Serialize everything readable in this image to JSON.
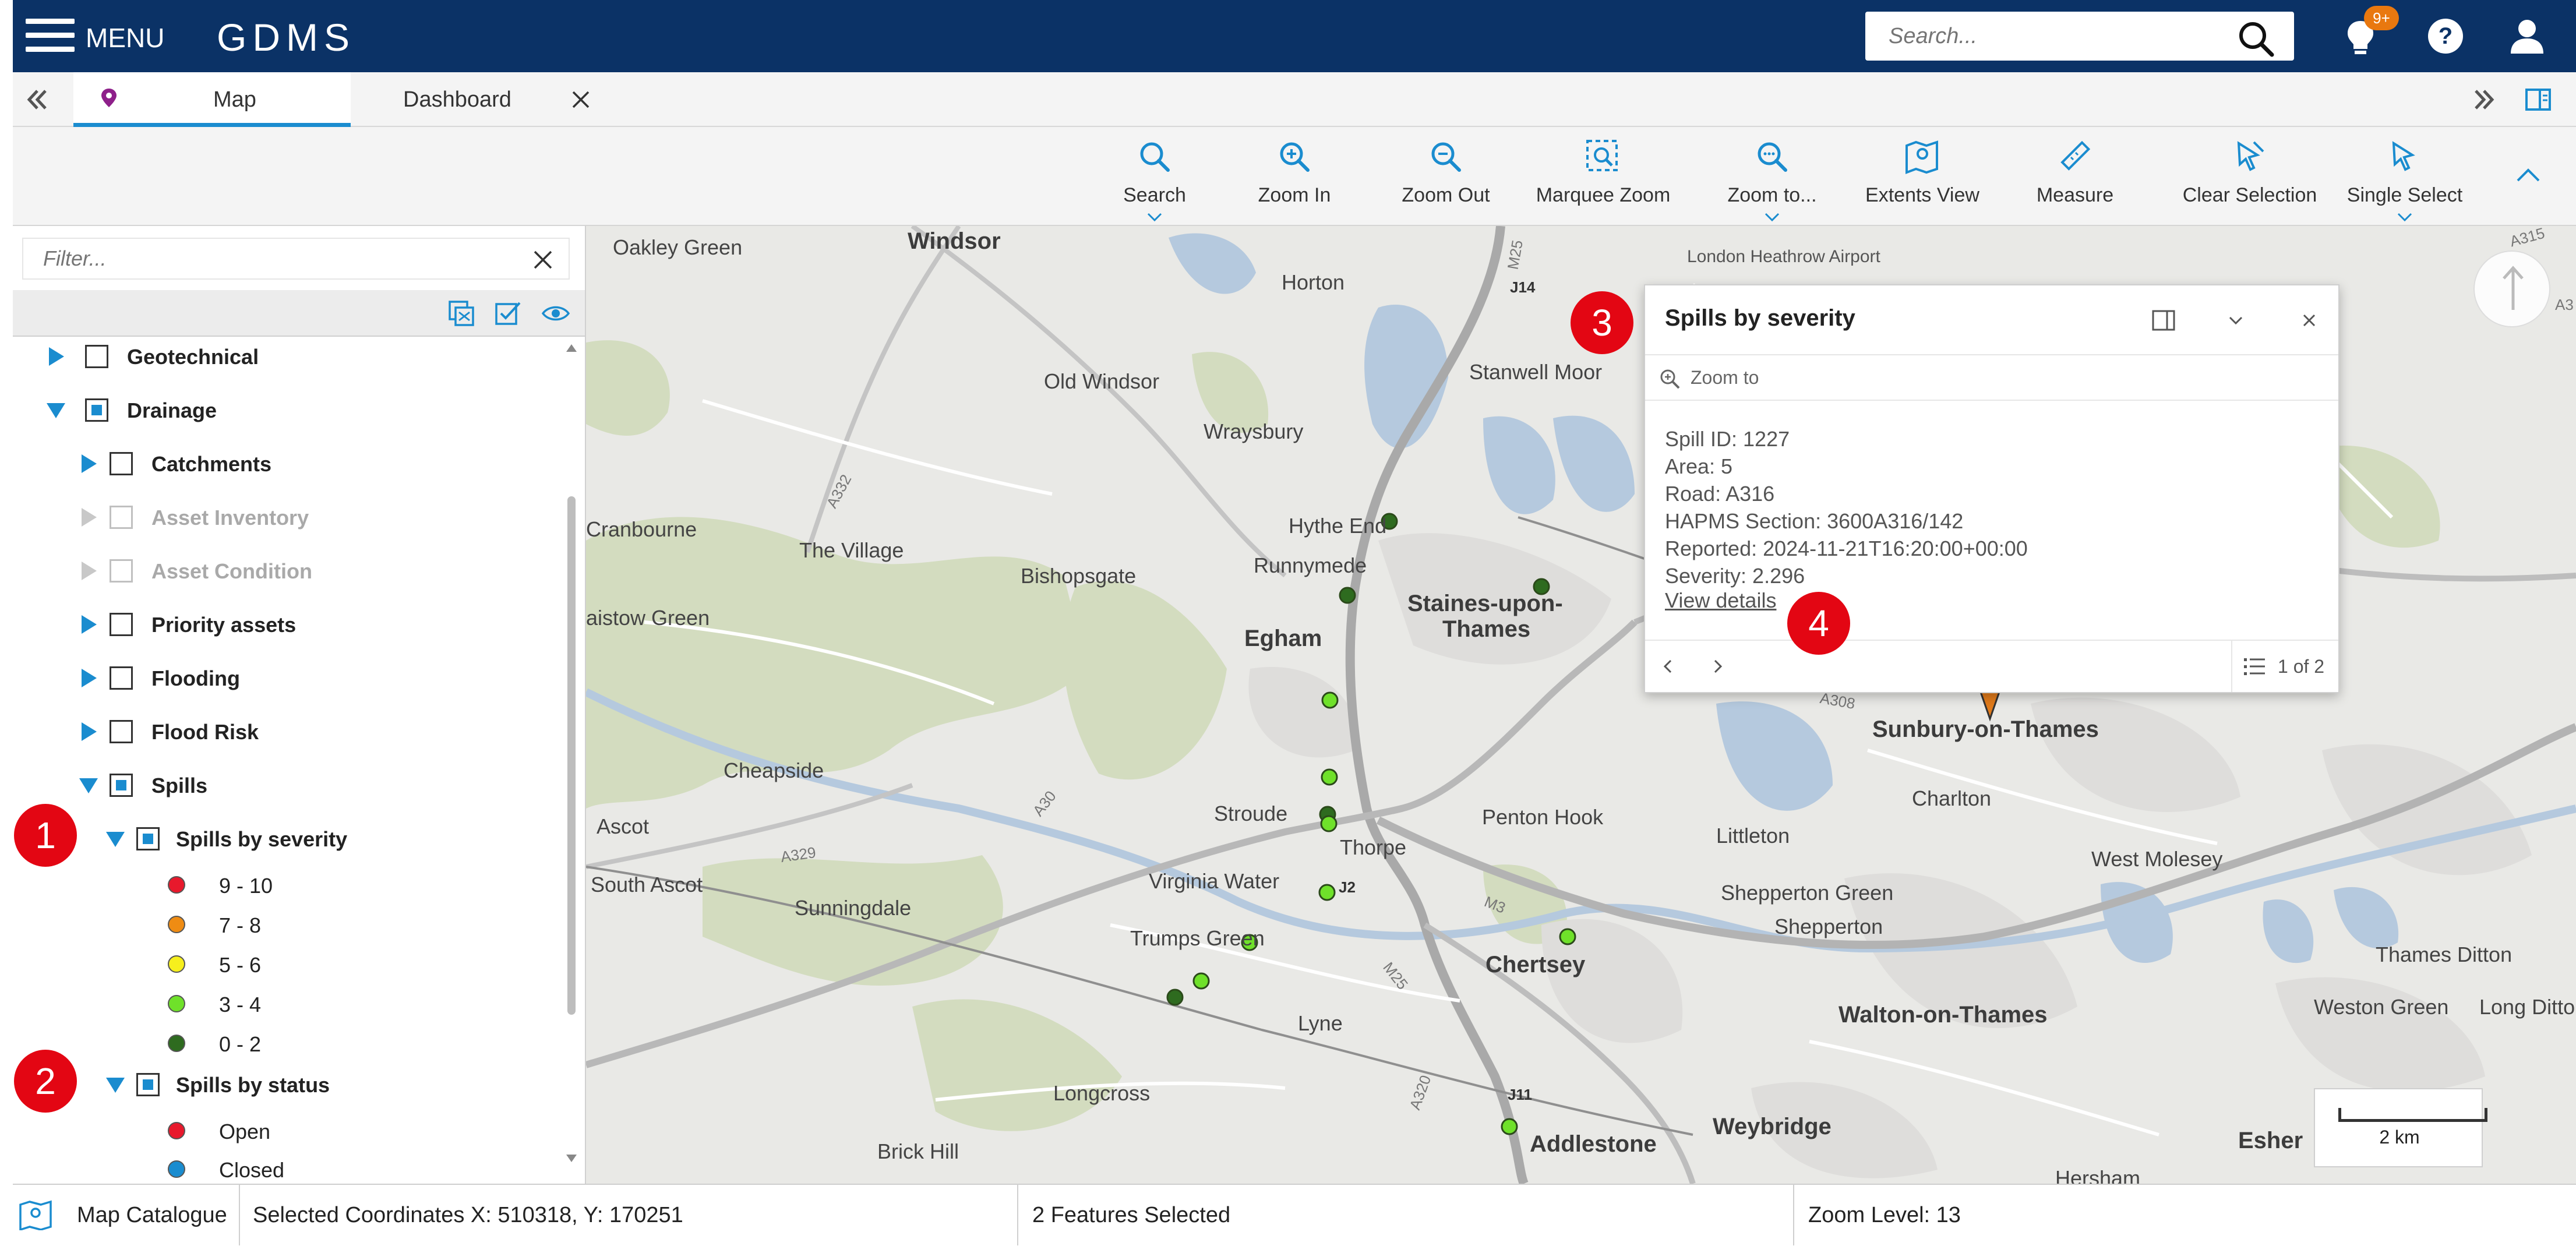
{
  "header": {
    "menu_label": "MENU",
    "app_title": "GDMS",
    "search_placeholder": "Search...",
    "notification_badge": "9+",
    "icons": [
      "menu-icon",
      "search-icon",
      "lightbulb-icon",
      "help-icon",
      "user-icon"
    ],
    "background_color": "#0b3266"
  },
  "tabs": [
    {
      "label": "Map",
      "icon": "map-pin-icon",
      "active": true
    },
    {
      "label": "Dashboard",
      "closable": true
    }
  ],
  "toolbar": {
    "tools": [
      {
        "label": "Search",
        "icon": "search-icon",
        "has_dropdown": true
      },
      {
        "label": "Zoom In",
        "icon": "zoom-in-icon"
      },
      {
        "label": "Zoom Out",
        "icon": "zoom-out-icon"
      },
      {
        "label": "Marquee Zoom",
        "icon": "marquee-zoom-icon"
      },
      {
        "label": "Zoom to...",
        "icon": "zoom-to-icon",
        "has_dropdown": true
      },
      {
        "label": "Extents View",
        "icon": "map-extent-icon"
      },
      {
        "label": "Measure",
        "icon": "ruler-icon"
      },
      {
        "label": "Clear Selection",
        "icon": "clear-selection-icon"
      },
      {
        "label": "Single Select",
        "icon": "cursor-icon",
        "has_dropdown": true
      }
    ],
    "accent_color": "#1a8ccf"
  },
  "layer_panel": {
    "filter_placeholder": "Filter...",
    "tree": [
      {
        "label": "Geotechnical",
        "level": 1,
        "expanded": false,
        "checked": "none",
        "enabled": true
      },
      {
        "label": "Drainage",
        "level": 1,
        "expanded": true,
        "checked": "partial",
        "enabled": true
      },
      {
        "label": "Catchments",
        "level": 2,
        "expanded": false,
        "checked": "none",
        "enabled": true
      },
      {
        "label": "Asset Inventory",
        "level": 2,
        "expanded": false,
        "checked": "none",
        "enabled": false
      },
      {
        "label": "Asset Condition",
        "level": 2,
        "expanded": false,
        "checked": "none",
        "enabled": false
      },
      {
        "label": "Priority assets",
        "level": 2,
        "expanded": false,
        "checked": "none",
        "enabled": true
      },
      {
        "label": "Flooding",
        "level": 2,
        "expanded": false,
        "checked": "none",
        "enabled": true
      },
      {
        "label": "Flood Risk",
        "level": 2,
        "expanded": false,
        "checked": "none",
        "enabled": true
      },
      {
        "label": "Spills",
        "level": 2,
        "expanded": true,
        "checked": "partial",
        "enabled": true
      }
    ],
    "severity_group": {
      "label": "Spills by severity",
      "legend": [
        {
          "label": "9 - 10",
          "color": "#e8192c"
        },
        {
          "label": "7 - 8",
          "color": "#ef8c13"
        },
        {
          "label": "5 - 6",
          "color": "#f6ef1d"
        },
        {
          "label": "3 - 4",
          "color": "#6fe12a"
        },
        {
          "label": "0 - 2",
          "color": "#2e6b1f"
        }
      ]
    },
    "status_group": {
      "label": "Spills by status",
      "legend": [
        {
          "label": "Open",
          "color": "#e8192c"
        },
        {
          "label": "Closed",
          "color": "#1a8ccf"
        }
      ]
    }
  },
  "callouts": [
    "1",
    "2",
    "3",
    "4"
  ],
  "map": {
    "places": [
      {
        "text": "Windsor",
        "size": "big"
      },
      {
        "text": "Oakley Green"
      },
      {
        "text": "Horton"
      },
      {
        "text": "London Heathrow Airport",
        "size": "small"
      },
      {
        "text": "Old Windsor"
      },
      {
        "text": "Stanwell Moor"
      },
      {
        "text": "Wraysbury"
      },
      {
        "text": "Cranbourne"
      },
      {
        "text": "The Village"
      },
      {
        "text": "Hythe End"
      },
      {
        "text": "Runnymede"
      },
      {
        "text": "Bishopsgate"
      },
      {
        "text": "Staines-upon-",
        "size": "big"
      },
      {
        "text": "Thames",
        "size": "big"
      },
      {
        "text": "aistow Green"
      },
      {
        "text": "Egham",
        "size": "big"
      },
      {
        "text": "Sunbury-on-Thames",
        "size": "big"
      },
      {
        "text": "Cheapside"
      },
      {
        "text": "Charlton"
      },
      {
        "text": "Stroude"
      },
      {
        "text": "Penton Hook"
      },
      {
        "text": "Ascot"
      },
      {
        "text": "Thorpe"
      },
      {
        "text": "Littleton"
      },
      {
        "text": "West Molesey"
      },
      {
        "text": "South Ascot"
      },
      {
        "text": "Sunningdale"
      },
      {
        "text": "Virginia Water"
      },
      {
        "text": "Shepperton Green"
      },
      {
        "text": "Shepperton"
      },
      {
        "text": "Trumps Green"
      },
      {
        "text": "Chertsey",
        "size": "big"
      },
      {
        "text": "Thames Ditton"
      },
      {
        "text": "Walton-on-Thames",
        "size": "big"
      },
      {
        "text": "Weston Green"
      },
      {
        "text": "Long Ditton"
      },
      {
        "text": "Lyne"
      },
      {
        "text": "Longcross"
      },
      {
        "text": "Addlestone",
        "size": "big"
      },
      {
        "text": "Weybridge",
        "size": "big"
      },
      {
        "text": "Esher",
        "size": "big"
      },
      {
        "text": "Brick Hill"
      },
      {
        "text": "Hersham"
      }
    ],
    "road_labels": [
      "M25",
      "J14",
      "A332",
      "A30",
      "A329",
      "J2",
      "M3",
      "M25",
      "A320",
      "J11",
      "A308",
      "A315",
      "A3"
    ],
    "scale_label": "2 km",
    "north_arrow_icon": "north-arrow-icon"
  },
  "popup": {
    "title": "Spills by severity",
    "zoom_to": "Zoom to",
    "fields": [
      "Spill ID: 1227",
      "Area: 5",
      "Road: A316",
      "HAPMS Section: 3600A316/142",
      "Reported: 2024-11-21T16:20:00+00:00",
      "Severity: 2.296"
    ],
    "view_details": "View details",
    "pager": "1 of 2"
  },
  "statusbar": {
    "catalogue": "Map Catalogue",
    "coordinates": "Selected Coordinates X: 510318, Y: 170251",
    "features": "2 Features Selected",
    "zoom": "Zoom Level: 13"
  }
}
